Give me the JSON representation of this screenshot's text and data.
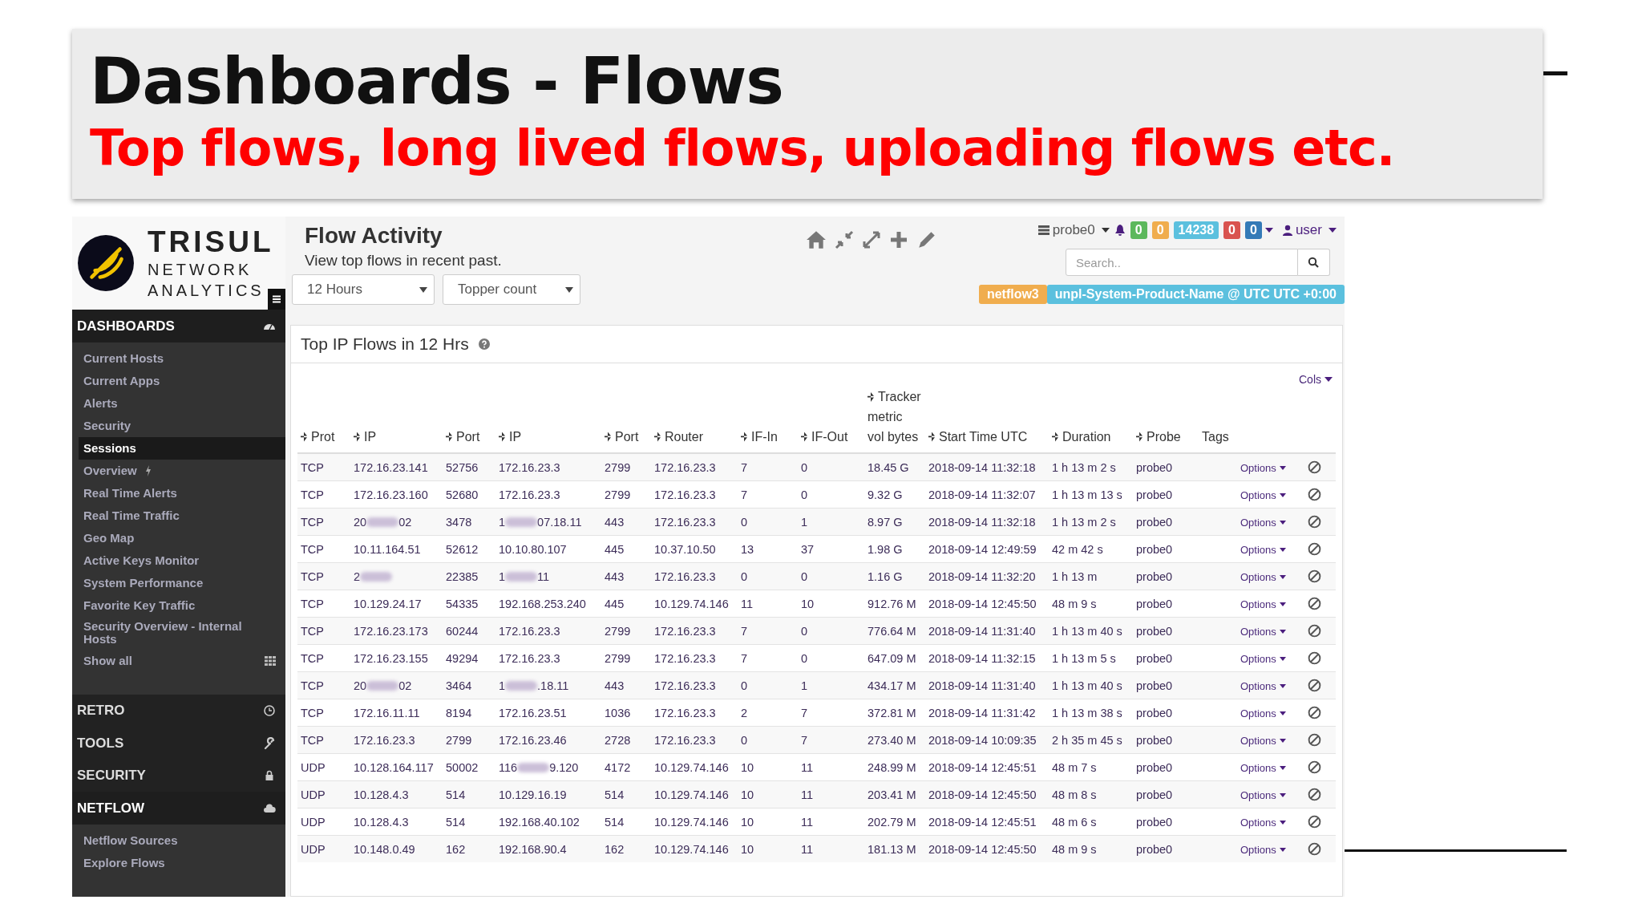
{
  "slide": {
    "title": "Dashboards - Flows",
    "subtitle": "Top flows, long lived flows, uploading flows etc."
  },
  "app": {
    "logo": {
      "name": "TRISUL",
      "tagline_1": "NETWORK",
      "tagline_2": "ANALYTICS"
    },
    "sidebar": {
      "sections": [
        {
          "title": "DASHBOARDS",
          "expanded": true,
          "items": [
            {
              "label": "Current Hosts",
              "selected": false,
              "kind": "plain"
            },
            {
              "label": "Current Apps",
              "selected": false,
              "kind": "plain"
            },
            {
              "label": "Alerts",
              "selected": false,
              "kind": "plain"
            },
            {
              "label": "Security",
              "selected": false,
              "kind": "plain"
            },
            {
              "label": "Sessions",
              "selected": true,
              "kind": "plain"
            },
            {
              "label": "Overview",
              "selected": false,
              "kind": "live"
            },
            {
              "label": "Real Time Alerts",
              "selected": false,
              "kind": "plain"
            },
            {
              "label": "Real Time Traffic",
              "selected": false,
              "kind": "plain"
            },
            {
              "label": "Geo Map",
              "selected": false,
              "kind": "plain"
            },
            {
              "label": "Active Keys Monitor",
              "selected": false,
              "kind": "plain"
            },
            {
              "label": "System Performance",
              "selected": false,
              "kind": "plain"
            },
            {
              "label": "Favorite Key Traffic",
              "selected": false,
              "kind": "plain"
            },
            {
              "label": "Security Overview - Internal Hosts",
              "selected": false,
              "kind": "plain"
            },
            {
              "label": "Show all",
              "selected": false,
              "kind": "more"
            }
          ]
        },
        {
          "title": "RETRO",
          "expanded": false
        },
        {
          "title": "TOOLS",
          "expanded": false
        },
        {
          "title": "SECURITY",
          "expanded": false
        },
        {
          "title": "NETFLOW",
          "expanded": true,
          "items": [
            {
              "label": "Netflow Sources",
              "selected": false,
              "kind": "plain"
            },
            {
              "label": "Explore Flows",
              "selected": false,
              "kind": "plain"
            }
          ]
        }
      ]
    },
    "header": {
      "title": "Flow Activity",
      "subtitle": "View top flows in recent past.",
      "selects": [
        {
          "value": "12 Hours"
        },
        {
          "value": "Topper count"
        }
      ],
      "probe": "probe0",
      "badges": [
        {
          "text": "0",
          "color": "#5cb85c"
        },
        {
          "text": "0",
          "color": "#f0ad4e"
        },
        {
          "text": "14238",
          "color": "#5bc0de"
        },
        {
          "text": "0",
          "color": "#d9534f"
        },
        {
          "text": "0",
          "color": "#337ab7"
        }
      ],
      "user": "user",
      "search": {
        "placeholder": "Search.."
      },
      "labels": [
        {
          "text": "netflow3",
          "color": "#f0ad4e"
        },
        {
          "text": "unpl-System-Product-Name @ UTC UTC +0:00",
          "color": "#5bc0de"
        }
      ]
    },
    "panel": {
      "title": "Top IP Flows in 12 Hrs",
      "cols_menu": "Cols",
      "table": {
        "columns": [
          {
            "label": "Prot",
            "sortable": true
          },
          {
            "label": "IP",
            "sortable": true
          },
          {
            "label": "Port",
            "sortable": true
          },
          {
            "label": "IP",
            "sortable": true
          },
          {
            "label": "Port",
            "sortable": true
          },
          {
            "label": "Router",
            "sortable": true
          },
          {
            "label": "IF-In",
            "sortable": true
          },
          {
            "label": "IF-Out",
            "sortable": true
          },
          {
            "label": "Tracker metric vol bytes",
            "sortable": true
          },
          {
            "label": "Start Time UTC",
            "sortable": true
          },
          {
            "label": "Duration",
            "sortable": true
          },
          {
            "label": "Probe",
            "sortable": true
          },
          {
            "label": "Tags",
            "sortable": false
          }
        ],
        "rows": [
          {
            "cells": [
              "TCP",
              "172.16.23.141",
              "52756",
              "172.16.23.3",
              "2799",
              "172.16.23.3",
              "7",
              "0",
              "18.45 G",
              "2018-09-14 11:32:18",
              "1 h 13 m 2 s",
              "probe0"
            ],
            "options": "Options"
          },
          {
            "cells": [
              "TCP",
              "172.16.23.160",
              "52680",
              "172.16.23.3",
              "2799",
              "172.16.23.3",
              "7",
              "0",
              "9.32 G",
              "2018-09-14 11:32:07",
              "1 h 13 m 13 s",
              "probe0"
            ],
            "options": "Options"
          },
          {
            "cells": [
              "TCP",
              {
                "start": "20",
                "end": "02"
              },
              "3478",
              {
                "start": "1",
                "end": "07.18.11"
              },
              "443",
              "172.16.23.3",
              "0",
              "1",
              "8.97 G",
              "2018-09-14 11:32:18",
              "1 h 13 m 2 s",
              "probe0"
            ],
            "options": "Options"
          },
          {
            "cells": [
              "TCP",
              "10.11.164.51",
              "52612",
              "10.10.80.107",
              "445",
              "10.37.10.50",
              "13",
              "37",
              "1.98 G",
              "2018-09-14 12:49:59",
              "42 m 42 s",
              "probe0"
            ],
            "options": "Options"
          },
          {
            "cells": [
              "TCP",
              {
                "start": "2"
              },
              "22385",
              {
                "start": "1",
                "end": "11"
              },
              "443",
              "172.16.23.3",
              "0",
              "0",
              "1.16 G",
              "2018-09-14 11:32:20",
              "1 h 13 m",
              "probe0"
            ],
            "options": "Options"
          },
          {
            "cells": [
              "TCP",
              "10.129.24.17",
              "54335",
              "192.168.253.240",
              "445",
              "10.129.74.146",
              "11",
              "10",
              "912.76 M",
              "2018-09-14 12:45:50",
              "48 m 9 s",
              "probe0"
            ],
            "options": "Options"
          },
          {
            "cells": [
              "TCP",
              "172.16.23.173",
              "60244",
              "172.16.23.3",
              "2799",
              "172.16.23.3",
              "7",
              "0",
              "776.64 M",
              "2018-09-14 11:31:40",
              "1 h 13 m 40 s",
              "probe0"
            ],
            "options": "Options"
          },
          {
            "cells": [
              "TCP",
              "172.16.23.155",
              "49294",
              "172.16.23.3",
              "2799",
              "172.16.23.3",
              "7",
              "0",
              "647.09 M",
              "2018-09-14 11:32:15",
              "1 h 13 m 5 s",
              "probe0"
            ],
            "options": "Options"
          },
          {
            "cells": [
              "TCP",
              {
                "start": "20",
                "end": "02"
              },
              "3464",
              {
                "start": "1",
                "end": ".18.11"
              },
              "443",
              "172.16.23.3",
              "0",
              "1",
              "434.17 M",
              "2018-09-14 11:31:40",
              "1 h 13 m 40 s",
              "probe0"
            ],
            "options": "Options"
          },
          {
            "cells": [
              "TCP",
              "172.16.11.11",
              "8194",
              "172.16.23.51",
              "1036",
              "172.16.23.3",
              "2",
              "7",
              "372.81 M",
              "2018-09-14 11:31:42",
              "1 h 13 m 38 s",
              "probe0"
            ],
            "options": "Options"
          },
          {
            "cells": [
              "TCP",
              "172.16.23.3",
              "2799",
              "172.16.23.46",
              "2728",
              "172.16.23.3",
              "0",
              "7",
              "273.40 M",
              "2018-09-14 10:09:35",
              "2 h 35 m 45 s",
              "probe0"
            ],
            "options": "Options"
          },
          {
            "cells": [
              "UDP",
              "10.128.164.117",
              "50002",
              {
                "start": "116",
                "end": "9.120"
              },
              "4172",
              "10.129.74.146",
              "10",
              "11",
              "248.99 M",
              "2018-09-14 12:45:51",
              "48 m 7 s",
              "probe0"
            ],
            "options": "Options"
          },
          {
            "cells": [
              "UDP",
              "10.128.4.3",
              "514",
              "10.129.16.19",
              "514",
              "10.129.74.146",
              "10",
              "11",
              "203.41 M",
              "2018-09-14 12:45:50",
              "48 m 8 s",
              "probe0"
            ],
            "options": "Options"
          },
          {
            "cells": [
              "UDP",
              "10.128.4.3",
              "514",
              "192.168.40.102",
              "514",
              "10.129.74.146",
              "10",
              "11",
              "202.79 M",
              "2018-09-14 12:45:51",
              "48 m 6 s",
              "probe0"
            ],
            "options": "Options"
          },
          {
            "cells": [
              "UDP",
              "10.148.0.49",
              "162",
              "192.168.90.4",
              "162",
              "10.129.74.146",
              "10",
              "11",
              "181.13 M",
              "2018-09-14 12:45:50",
              "48 m 9 s",
              "probe0"
            ],
            "options": "Options"
          }
        ]
      }
    }
  }
}
